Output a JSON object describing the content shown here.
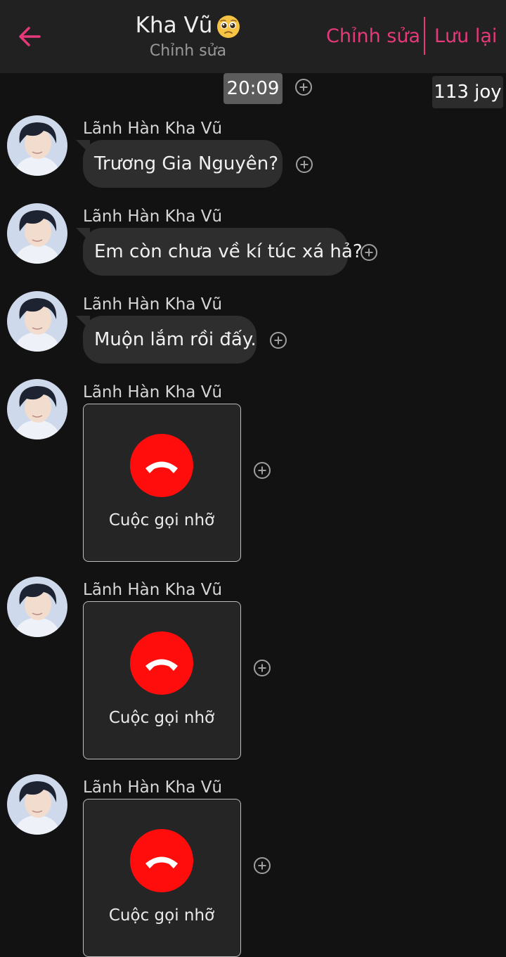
{
  "header": {
    "title": "Kha Vũ",
    "subtitle": "Chỉnh sửa",
    "edit_label": "Chỉnh sửa",
    "save_label": "Lưu lại",
    "accent_color": "#e6397a"
  },
  "chat": {
    "time": "20:09",
    "badge": "113 joy",
    "messages": [
      {
        "sender": "Lãnh Hàn Kha Vũ",
        "type": "text",
        "text": "Trương Gia Nguyên?"
      },
      {
        "sender": "Lãnh Hàn Kha Vũ",
        "type": "text",
        "text": "Em còn chưa về kí túc xá hả?"
      },
      {
        "sender": "Lãnh Hàn Kha Vũ",
        "type": "text",
        "text": "Muộn lắm rồi đấy."
      },
      {
        "sender": "Lãnh Hàn Kha Vũ",
        "type": "call",
        "text": "Cuộc gọi nhỡ"
      },
      {
        "sender": "Lãnh Hàn Kha Vũ",
        "type": "call",
        "text": "Cuộc gọi nhỡ"
      },
      {
        "sender": "Lãnh Hàn Kha Vũ",
        "type": "call",
        "text": "Cuộc gọi nhỡ"
      }
    ]
  },
  "icons": {
    "back": "arrow-left-icon",
    "emoji": "pleading-face-icon",
    "add": "plus-circle-icon",
    "call": "phone-hangup-icon"
  },
  "colors": {
    "background": "#121212",
    "bubble": "#2e2e2e",
    "missed_call": "#ff0d0d"
  }
}
